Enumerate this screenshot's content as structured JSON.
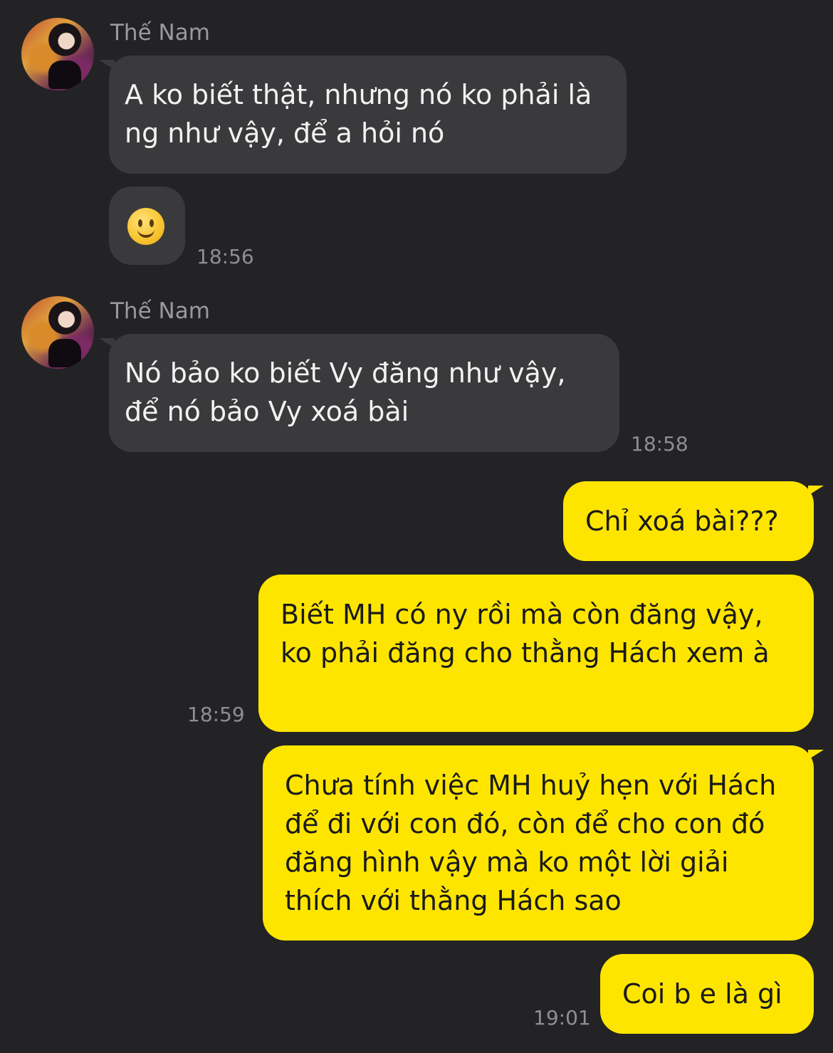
{
  "colors": {
    "background": "#232325",
    "incoming_bubble": "#3a3a3c",
    "outgoing_bubble": "#fee500"
  },
  "groups": [
    {
      "sender": "Thế Nam",
      "messages": [
        {
          "text": "A ko biết thật, nhưng nó ko phải là ng như vậy, để a hỏi nó"
        },
        {
          "emoji": "slightly-smiling-face",
          "time": "18:56"
        }
      ]
    },
    {
      "sender": "Thế Nam",
      "messages": [
        {
          "text": "Nó bảo ko biết Vy đăng như vậy, để nó bảo Vy xoá bài",
          "time": "18:58"
        }
      ]
    }
  ],
  "outgoing": [
    {
      "text": "Chỉ xoá bài???"
    },
    {
      "text": "Biết MH có ny rồi mà còn đăng vậy, ko phải đăng cho thằng Hách xem à",
      "time": "18:59"
    },
    {
      "text": "Chưa tính việc MH huỷ hẹn với Hách để đi với con đó, còn để cho con đó đăng hình vậy mà ko một lời giải thích với thằng Hách sao"
    },
    {
      "text": "Coi b e là gì",
      "time": "19:01"
    }
  ]
}
